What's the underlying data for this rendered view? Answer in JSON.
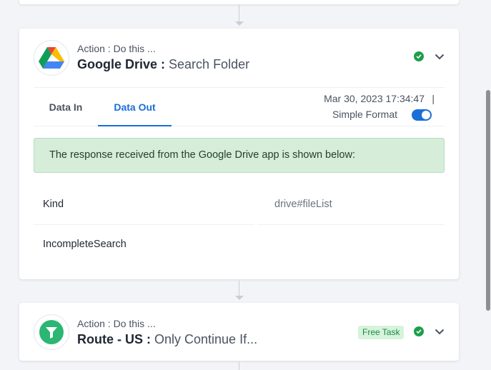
{
  "steps": [
    {
      "kicker": "Action : Do this ...",
      "app": "Google Drive",
      "separator": " : ",
      "event": "Search Folder",
      "logo_icon": "google-drive-icon",
      "status_icon": "check-circle-icon",
      "tabs": [
        {
          "label": "Data In",
          "active": false
        },
        {
          "label": "Data Out",
          "active": true
        }
      ],
      "timestamp": "Mar 30, 2023 17:34:47",
      "timestamp_separator": "|",
      "format_label": "Simple Format",
      "format_enabled": true,
      "response_message": "The response received from the Google Drive app is shown below:",
      "rows": [
        {
          "key": "Kind",
          "value": "drive#fileList"
        },
        {
          "key": "IncompleteSearch",
          "value": ""
        }
      ]
    },
    {
      "kicker": "Action : Do this ...",
      "app": "Route - US",
      "separator": " : ",
      "event": "Only Continue If...",
      "logo_icon": "filter-icon",
      "badge": "Free Task",
      "status_icon": "check-circle-icon"
    }
  ],
  "colors": {
    "accent": "#1a6fd8",
    "success": "#1e9e4c",
    "banner_bg": "#d5edd9",
    "router_green": "#2bb673"
  }
}
